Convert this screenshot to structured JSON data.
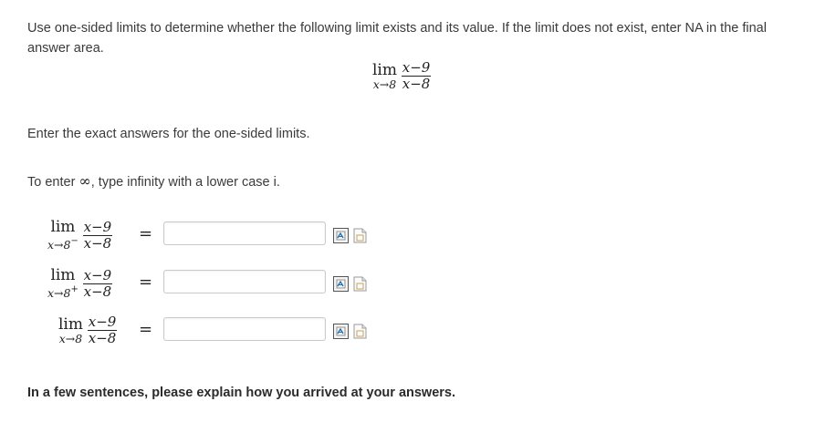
{
  "problem": {
    "instructions": "Use one-sided limits to determine whether the following limit exists and its value. If the limit does not exist, enter NA in the final answer area.",
    "main_limit": {
      "lim": "lim",
      "sub": "x→8",
      "num": "x−9",
      "den": "x−8"
    }
  },
  "exact_note": "Enter the exact answers for the one-sided limits.",
  "infinity_note": {
    "before": "To enter ",
    "symbol": "∞",
    "after": ", type infinity with a lower case i."
  },
  "rows": [
    {
      "lim": "lim",
      "sub": "x→8",
      "side": "−",
      "num": "x−9",
      "den": "x−8",
      "eq": "=",
      "value": ""
    },
    {
      "lim": "lim",
      "sub": "x→8",
      "side": "+",
      "num": "x−9",
      "den": "x−8",
      "eq": "=",
      "value": ""
    },
    {
      "lim": "lim",
      "sub": "x→8",
      "side": "",
      "num": "x−9",
      "den": "x−8",
      "eq": "=",
      "value": ""
    }
  ],
  "icons": [
    "equation-editor-icon",
    "notepad-icon"
  ],
  "explain_prompt": "In a few sentences, please explain how you arrived at your answers."
}
